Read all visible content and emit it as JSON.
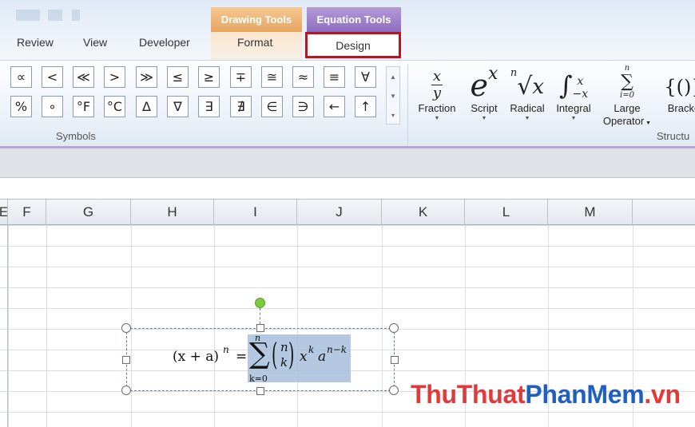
{
  "ribbon": {
    "context_tabs": {
      "drawing_tools": "Drawing Tools",
      "equation_tools": "Equation Tools"
    },
    "tabs": {
      "review": "Review",
      "view": "View",
      "developer": "Developer",
      "format": "Format",
      "design": "Design"
    },
    "symbols_group": {
      "label": "Symbols",
      "row1": [
        "∝",
        "<",
        "≪",
        ">",
        "≫",
        "≤",
        "≥",
        "∓",
        "≅",
        "≈",
        "≡",
        "∀"
      ],
      "row2": [
        "%",
        "∘",
        "°F",
        "°C",
        "∆",
        "∇",
        "∃",
        "∄",
        "∈",
        "∋",
        "←",
        "↑"
      ]
    },
    "structures_group": {
      "label": "Structu",
      "items": {
        "fraction": "Fraction",
        "script": "Script",
        "radical": "Radical",
        "integral": "Integral",
        "large_operator_1": "Large",
        "large_operator_2": "Operator",
        "bracket": "Bracke"
      }
    }
  },
  "sheet": {
    "columns": [
      "E",
      "F",
      "G",
      "H",
      "I",
      "J",
      "K",
      "L",
      "M"
    ]
  },
  "equation": {
    "lhs": "(x + a)",
    "lhs_exp": "n",
    "equals": "=",
    "sum": "∑",
    "sum_upper": "n",
    "sum_lower": "k=0",
    "binom_top": "n",
    "binom_bottom": "k",
    "x": "x",
    "x_exp": "k",
    "a": "a",
    "a_exp": "n−k"
  },
  "watermark": {
    "part1": "ThuThuat",
    "part2": "PhanMem",
    "part3": ".vn"
  },
  "colors": {
    "highlight_box": "#b3171f",
    "drawing_tools": "#e6a461",
    "equation_tools": "#8c6cc0",
    "watermark_red": "#e23a3a",
    "watermark_blue": "#1f5fbf"
  }
}
